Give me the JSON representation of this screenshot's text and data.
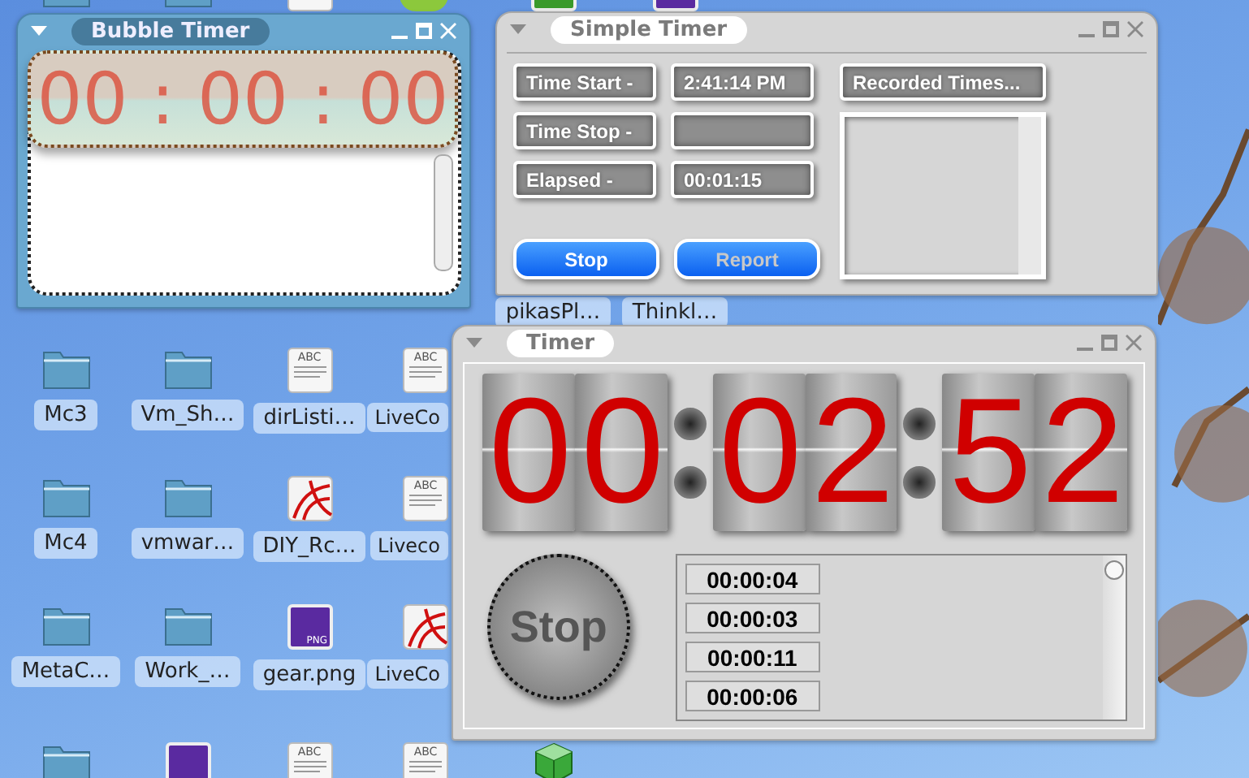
{
  "desktop": {
    "rows": [
      {
        "icons": [
          {
            "kind": "folder"
          },
          {
            "kind": "folder"
          },
          {
            "kind": "text"
          },
          {
            "kind": "app"
          },
          {
            "kind": "image",
            "color": "#3a9a2a"
          },
          {
            "kind": "image",
            "color": "#5a2aa0"
          }
        ]
      },
      {
        "icons": [
          {
            "kind": "none",
            "label": "pikasPl…"
          },
          {
            "kind": "none",
            "label": "Thinkl…"
          }
        ]
      },
      {
        "icons": [
          {
            "kind": "folder",
            "label": "Mc3"
          },
          {
            "kind": "folder",
            "label": "Vm_Sh…"
          },
          {
            "kind": "text",
            "badge": "ABC",
            "label": "dirListi…"
          },
          {
            "kind": "text",
            "badge": "ABC",
            "label": "LiveCo"
          }
        ]
      },
      {
        "icons": [
          {
            "kind": "folder",
            "label": "Mc4"
          },
          {
            "kind": "folder",
            "label": "vmwar…"
          },
          {
            "kind": "pdf",
            "label": "DIY_Rc…"
          },
          {
            "kind": "text",
            "badge": "ABC",
            "label": "Liveco"
          }
        ]
      },
      {
        "icons": [
          {
            "kind": "folder",
            "label": "MetaC…"
          },
          {
            "kind": "folder",
            "label": "Work_…"
          },
          {
            "kind": "image",
            "badge": "PNG",
            "color": "#5a2aa0",
            "label": "gear.png"
          },
          {
            "kind": "pdf",
            "label": "LiveCo"
          }
        ]
      },
      {
        "icons": [
          {
            "kind": "folder"
          },
          {
            "kind": "image",
            "color": "#5a2aa0"
          },
          {
            "kind": "text",
            "badge": "ABC"
          },
          {
            "kind": "text",
            "badge": "ABC"
          },
          {
            "kind": "cube"
          }
        ]
      }
    ]
  },
  "bubble_timer": {
    "title": "Bubble Timer",
    "display": "00 : 00 : 00"
  },
  "simple_timer": {
    "title": "Simple Timer",
    "fields": [
      {
        "label": "Time Start -",
        "value": "2:41:14 PM"
      },
      {
        "label": "Time Stop -"
      },
      {
        "label": "Elapsed -",
        "value": "00:01:15"
      }
    ],
    "buttons": [
      {
        "label": "Stop",
        "disabled": false
      },
      {
        "label": "Report",
        "disabled": true
      }
    ],
    "recorded_header": "Recorded Times..."
  },
  "timer": {
    "title": "Timer",
    "groups": [
      "00",
      "02",
      "52"
    ],
    "stop_button": "Stop",
    "laps": [
      "00:00:04",
      "00:00:03",
      "00:00:11",
      "00:00:06"
    ]
  }
}
